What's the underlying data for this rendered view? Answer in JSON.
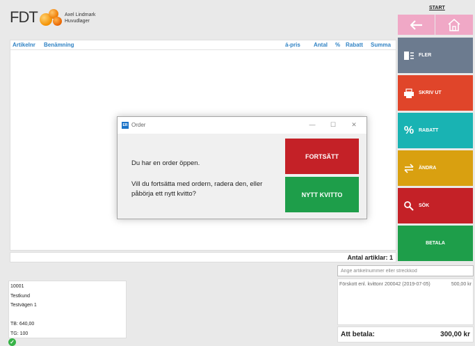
{
  "header": {
    "logo_text": "FDT",
    "user_name": "Axel Lindmark",
    "store_name": "Huvudlager"
  },
  "table": {
    "columns": [
      "Artikelnr",
      "Benämning",
      "á-pris",
      "Antal",
      "%",
      "Rabatt",
      "Summa"
    ],
    "rows": []
  },
  "summary": {
    "item_count_label": "Antal artiklar: 1"
  },
  "nav": {
    "start_label": "START",
    "back_icon": "arrow-left-icon",
    "home_icon": "home-icon"
  },
  "side_buttons": [
    {
      "label": "FLER",
      "color": "#6c7b8f",
      "icon": "more-icon"
    },
    {
      "label": "SKRIV UT",
      "color": "#e0452a",
      "icon": "printer-icon"
    },
    {
      "label": "RABATT",
      "color": "#19b3b3",
      "icon": "percent-icon"
    },
    {
      "label": "ÄNDRA",
      "color": "#d9a010",
      "icon": "swap-icon"
    },
    {
      "label": "SÖK",
      "color": "#c42127",
      "icon": "search-icon"
    },
    {
      "label": "BETALA",
      "color": "#1e9e4a",
      "icon": ""
    }
  ],
  "scan": {
    "placeholder": "Ange artikelnummer eller streckkod",
    "value": ""
  },
  "receipt": {
    "lines": [
      {
        "description": "Förskott enl. kvittonr 200042 (2019-07-05)",
        "amount": "500,00 kr"
      }
    ]
  },
  "payment": {
    "label": "Att betala:",
    "amount": "300,00 kr"
  },
  "customer": {
    "number": "10001",
    "name": "Testkund",
    "address": "Testvägen 1",
    "tb": "TB: 640,00",
    "tg": "TG: 100"
  },
  "dialog": {
    "app_icon_text": "ER",
    "title": "Order",
    "message1": "Du har en order öppen.",
    "message2": "Vill du fortsätta med ordern, radera den, eller påbörja ett nytt kvitto?",
    "continue_label": "FORTSÄTT",
    "new_receipt_label": "NYTT KVITTO",
    "continue_color": "#c42127",
    "new_receipt_color": "#1e9e4a"
  }
}
